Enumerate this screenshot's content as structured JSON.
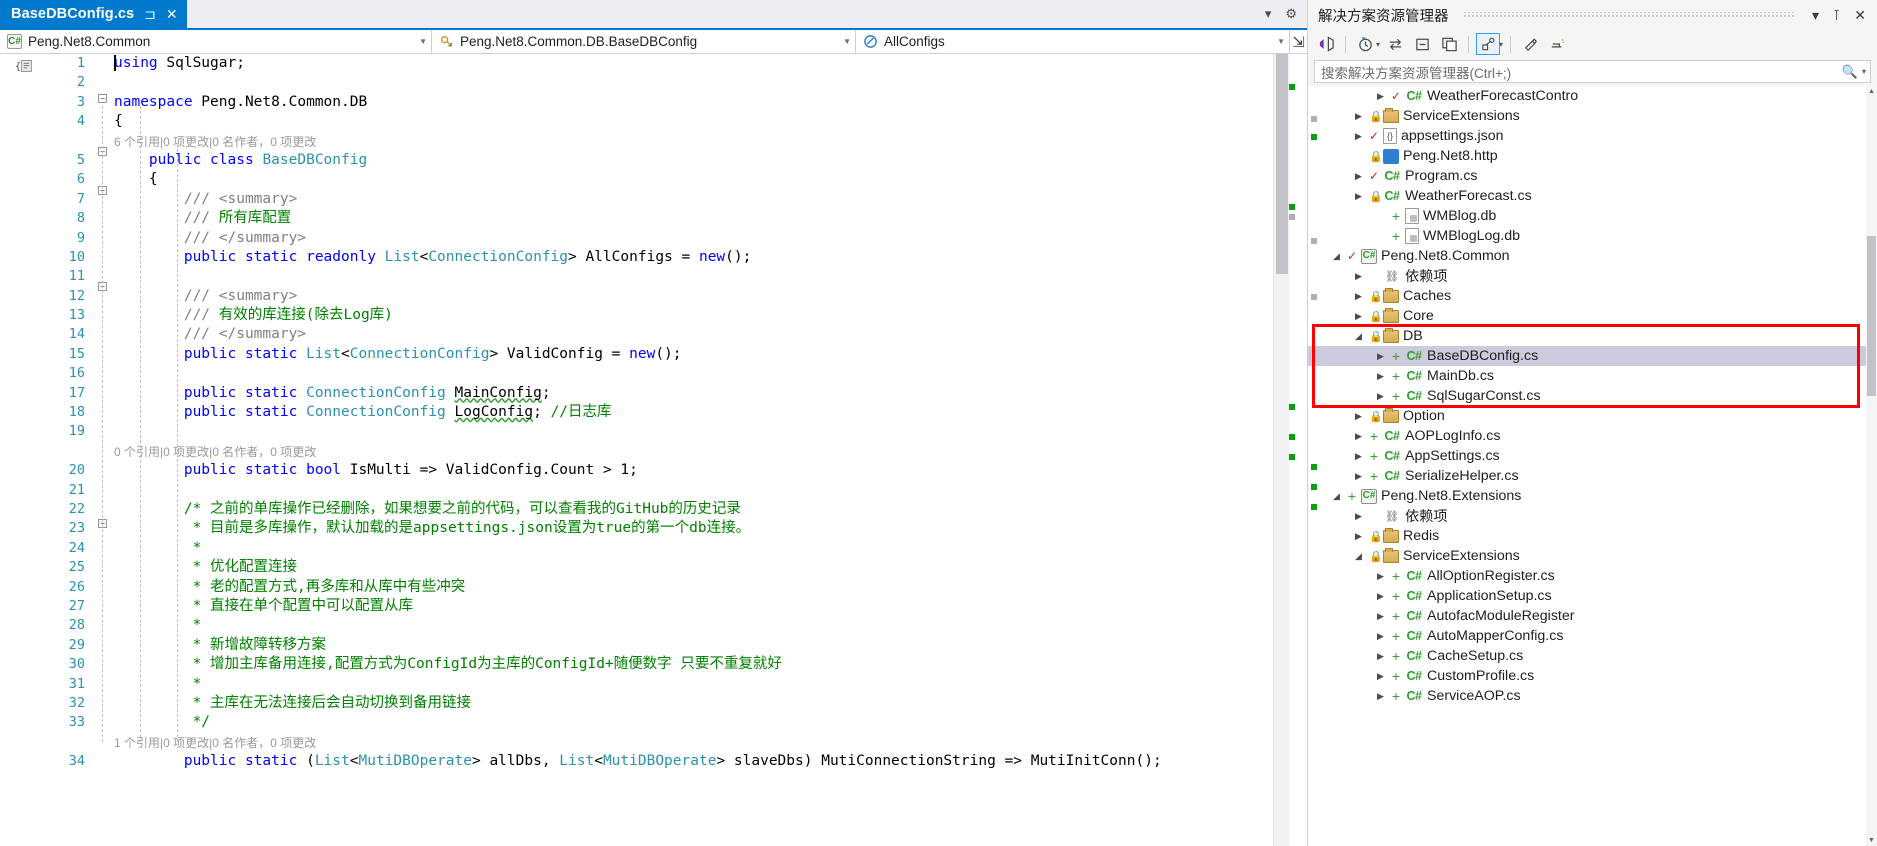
{
  "window": {
    "tab_title": "BaseDBConfig.cs",
    "pin_icon": "pin-icon",
    "close_icon": "close-icon",
    "dropdown_icon": "chevron-down-icon",
    "settings_icon": "gear-icon"
  },
  "navbar": {
    "project": "Peng.Net8.Common",
    "type": "Peng.Net8.Common.DB.BaseDBConfig",
    "member": "AllConfigs",
    "project_icon": "csharp-project-icon",
    "type_icon": "class-icon",
    "member_icon": "field-icon",
    "split_icon": "split-editor-icon"
  },
  "editor": {
    "lines": [
      {
        "n": "1",
        "meta": null,
        "text": "using SqlSugar;"
      },
      {
        "n": "2",
        "meta": null,
        "text": ""
      },
      {
        "n": "3",
        "meta": null,
        "text": "namespace Peng.Net8.Common.DB"
      },
      {
        "n": "4",
        "meta": null,
        "text": "{"
      },
      {
        "n": "5",
        "meta": "6 个引用|0 项更改|0 名作者，0 项更改",
        "text": "    public class BaseDBConfig"
      },
      {
        "n": "6",
        "meta": null,
        "text": "    {"
      },
      {
        "n": "7",
        "meta": null,
        "text": "        /// <summary>"
      },
      {
        "n": "8",
        "meta": null,
        "text": "        /// 所有库配置"
      },
      {
        "n": "9",
        "meta": null,
        "text": "        /// </summary>"
      },
      {
        "n": "10",
        "meta": null,
        "text": "        public static readonly List<ConnectionConfig> AllConfigs = new();"
      },
      {
        "n": "11",
        "meta": null,
        "text": ""
      },
      {
        "n": "12",
        "meta": null,
        "text": "        /// <summary>"
      },
      {
        "n": "13",
        "meta": null,
        "text": "        /// 有效的库连接(除去Log库)"
      },
      {
        "n": "14",
        "meta": null,
        "text": "        /// </summary>"
      },
      {
        "n": "15",
        "meta": null,
        "text": "        public static List<ConnectionConfig> ValidConfig = new();"
      },
      {
        "n": "16",
        "meta": null,
        "text": ""
      },
      {
        "n": "17",
        "meta": null,
        "text": "        public static ConnectionConfig MainConfig;"
      },
      {
        "n": "18",
        "meta": null,
        "text": "        public static ConnectionConfig LogConfig; //日志库"
      },
      {
        "n": "19",
        "meta": null,
        "text": ""
      },
      {
        "n": "20",
        "meta": "0 个引用|0 项更改|0 名作者，0 项更改",
        "text": "        public static bool IsMulti => ValidConfig.Count > 1;"
      },
      {
        "n": "21",
        "meta": null,
        "text": ""
      },
      {
        "n": "22",
        "meta": null,
        "text": "        /* 之前的单库操作已经删除，如果想要之前的代码，可以查看我的GitHub的历史记录"
      },
      {
        "n": "23",
        "meta": null,
        "text": "         * 目前是多库操作，默认加载的是appsettings.json设置为true的第一个db连接。"
      },
      {
        "n": "24",
        "meta": null,
        "text": "         *"
      },
      {
        "n": "25",
        "meta": null,
        "text": "         * 优化配置连接"
      },
      {
        "n": "26",
        "meta": null,
        "text": "         * 老的配置方式,再多库和从库中有些冲突"
      },
      {
        "n": "27",
        "meta": null,
        "text": "         * 直接在单个配置中可以配置从库"
      },
      {
        "n": "28",
        "meta": null,
        "text": "         *"
      },
      {
        "n": "29",
        "meta": null,
        "text": "         * 新增故障转移方案"
      },
      {
        "n": "30",
        "meta": null,
        "text": "         * 增加主库备用连接,配置方式为ConfigId为主库的ConfigId+随便数字 只要不重复就好"
      },
      {
        "n": "31",
        "meta": null,
        "text": "         *"
      },
      {
        "n": "32",
        "meta": null,
        "text": "         * 主库在无法连接后会自动切换到备用链接"
      },
      {
        "n": "33",
        "meta": null,
        "text": "         */"
      },
      {
        "n": "34",
        "meta": "1 个引用|0 项更改|0 名作者，0 项更改",
        "text": "        public static (List<MutiDBOperate> allDbs, List<MutiDBOperate> slaveDbs) MutiConnectionString => MutiInitConn();"
      }
    ]
  },
  "solution_explorer": {
    "title": "解决方案资源管理器",
    "header_icons": {
      "dropdown": "chevron-down-icon",
      "pin": "pin-icon",
      "close": "close-icon"
    },
    "toolbar_icons": [
      "code-view-icon",
      "pending-changes-icon",
      "sync-with-active-document-icon",
      "collapse-all-icon",
      "show-all-files-icon",
      "properties-icon",
      "refresh-icon",
      "home-icon"
    ],
    "search_placeholder": "搜索解决方案资源管理器(Ctrl+;)",
    "search_icon": "search-icon",
    "tree": [
      {
        "label": "WeatherForecastContro",
        "indent": 3,
        "expander": "collapsed",
        "status": "check",
        "icon": "csharp-file-icon",
        "selected": false
      },
      {
        "label": "ServiceExtensions",
        "indent": 2,
        "expander": "collapsed",
        "status": "lock",
        "icon": "folder-icon",
        "selected": false
      },
      {
        "label": "appsettings.json",
        "indent": 2,
        "expander": "collapsed",
        "status": "check",
        "icon": "json-file-icon",
        "selected": false
      },
      {
        "label": "Peng.Net8.http",
        "indent": 2,
        "expander": "none",
        "status": "lock",
        "icon": "http-file-icon",
        "selected": false
      },
      {
        "label": "Program.cs",
        "indent": 2,
        "expander": "collapsed",
        "status": "check",
        "icon": "csharp-file-icon",
        "selected": false
      },
      {
        "label": "WeatherForecast.cs",
        "indent": 2,
        "expander": "collapsed",
        "status": "lock",
        "icon": "csharp-file-icon",
        "selected": false
      },
      {
        "label": "WMBlog.db",
        "indent": 3,
        "expander": "none",
        "status": "plus",
        "icon": "db-file-icon",
        "selected": false
      },
      {
        "label": "WMBlogLog.db",
        "indent": 3,
        "expander": "none",
        "status": "plus",
        "icon": "db-file-icon",
        "selected": false
      },
      {
        "label": "Peng.Net8.Common",
        "indent": 1,
        "expander": "expanded",
        "status": "check",
        "icon": "csharp-project-icon",
        "selected": false
      },
      {
        "label": "依赖项",
        "indent": 2,
        "expander": "collapsed",
        "status": "none",
        "icon": "dependencies-icon",
        "selected": false
      },
      {
        "label": "Caches",
        "indent": 2,
        "expander": "collapsed",
        "status": "lock",
        "icon": "folder-icon",
        "selected": false
      },
      {
        "label": "Core",
        "indent": 2,
        "expander": "collapsed",
        "status": "lock",
        "icon": "folder-icon",
        "selected": false
      },
      {
        "label": "DB",
        "indent": 2,
        "expander": "expanded",
        "status": "lock",
        "icon": "folder-icon",
        "selected": false
      },
      {
        "label": "BaseDBConfig.cs",
        "indent": 3,
        "expander": "collapsed",
        "status": "plus",
        "icon": "csharp-file-icon",
        "selected": true
      },
      {
        "label": "MainDb.cs",
        "indent": 3,
        "expander": "collapsed",
        "status": "plus",
        "icon": "csharp-file-icon",
        "selected": false
      },
      {
        "label": "SqlSugarConst.cs",
        "indent": 3,
        "expander": "collapsed",
        "status": "plus",
        "icon": "csharp-file-icon",
        "selected": false
      },
      {
        "label": "Option",
        "indent": 2,
        "expander": "collapsed",
        "status": "lock",
        "icon": "folder-icon",
        "selected": false
      },
      {
        "label": "AOPLogInfo.cs",
        "indent": 2,
        "expander": "collapsed",
        "status": "plus",
        "icon": "csharp-file-icon",
        "selected": false
      },
      {
        "label": "AppSettings.cs",
        "indent": 2,
        "expander": "collapsed",
        "status": "plus",
        "icon": "csharp-file-icon",
        "selected": false
      },
      {
        "label": "SerializeHelper.cs",
        "indent": 2,
        "expander": "collapsed",
        "status": "plus",
        "icon": "csharp-file-icon",
        "selected": false
      },
      {
        "label": "Peng.Net8.Extensions",
        "indent": 1,
        "expander": "expanded",
        "status": "plus",
        "icon": "csharp-project-icon",
        "selected": false
      },
      {
        "label": "依赖项",
        "indent": 2,
        "expander": "collapsed",
        "status": "none",
        "icon": "dependencies-icon",
        "selected": false
      },
      {
        "label": "Redis",
        "indent": 2,
        "expander": "collapsed",
        "status": "lock",
        "icon": "folder-icon",
        "selected": false
      },
      {
        "label": "ServiceExtensions",
        "indent": 2,
        "expander": "expanded",
        "status": "lock",
        "icon": "folder-icon",
        "selected": false
      },
      {
        "label": "AllOptionRegister.cs",
        "indent": 3,
        "expander": "collapsed",
        "status": "plus",
        "icon": "csharp-file-icon",
        "selected": false
      },
      {
        "label": "ApplicationSetup.cs",
        "indent": 3,
        "expander": "collapsed",
        "status": "plus",
        "icon": "csharp-file-icon",
        "selected": false
      },
      {
        "label": "AutofacModuleRegister",
        "indent": 3,
        "expander": "collapsed",
        "status": "plus",
        "icon": "csharp-file-icon",
        "selected": false
      },
      {
        "label": "AutoMapperConfig.cs",
        "indent": 3,
        "expander": "collapsed",
        "status": "plus",
        "icon": "csharp-file-icon",
        "selected": false
      },
      {
        "label": "CacheSetup.cs",
        "indent": 3,
        "expander": "collapsed",
        "status": "plus",
        "icon": "csharp-file-icon",
        "selected": false
      },
      {
        "label": "CustomProfile.cs",
        "indent": 3,
        "expander": "collapsed",
        "status": "plus",
        "icon": "csharp-file-icon",
        "selected": false
      },
      {
        "label": "ServiceAOP.cs",
        "indent": 3,
        "expander": "collapsed",
        "status": "plus",
        "icon": "csharp-file-icon",
        "selected": false
      }
    ],
    "highlight_color": "#ff0000"
  },
  "colors": {
    "tab_active": "#007acc",
    "keyword": "#0000ff",
    "type": "#2b91af",
    "comment": "#008000",
    "linenumber": "#2b91af",
    "selection": "#cbcbdd"
  }
}
